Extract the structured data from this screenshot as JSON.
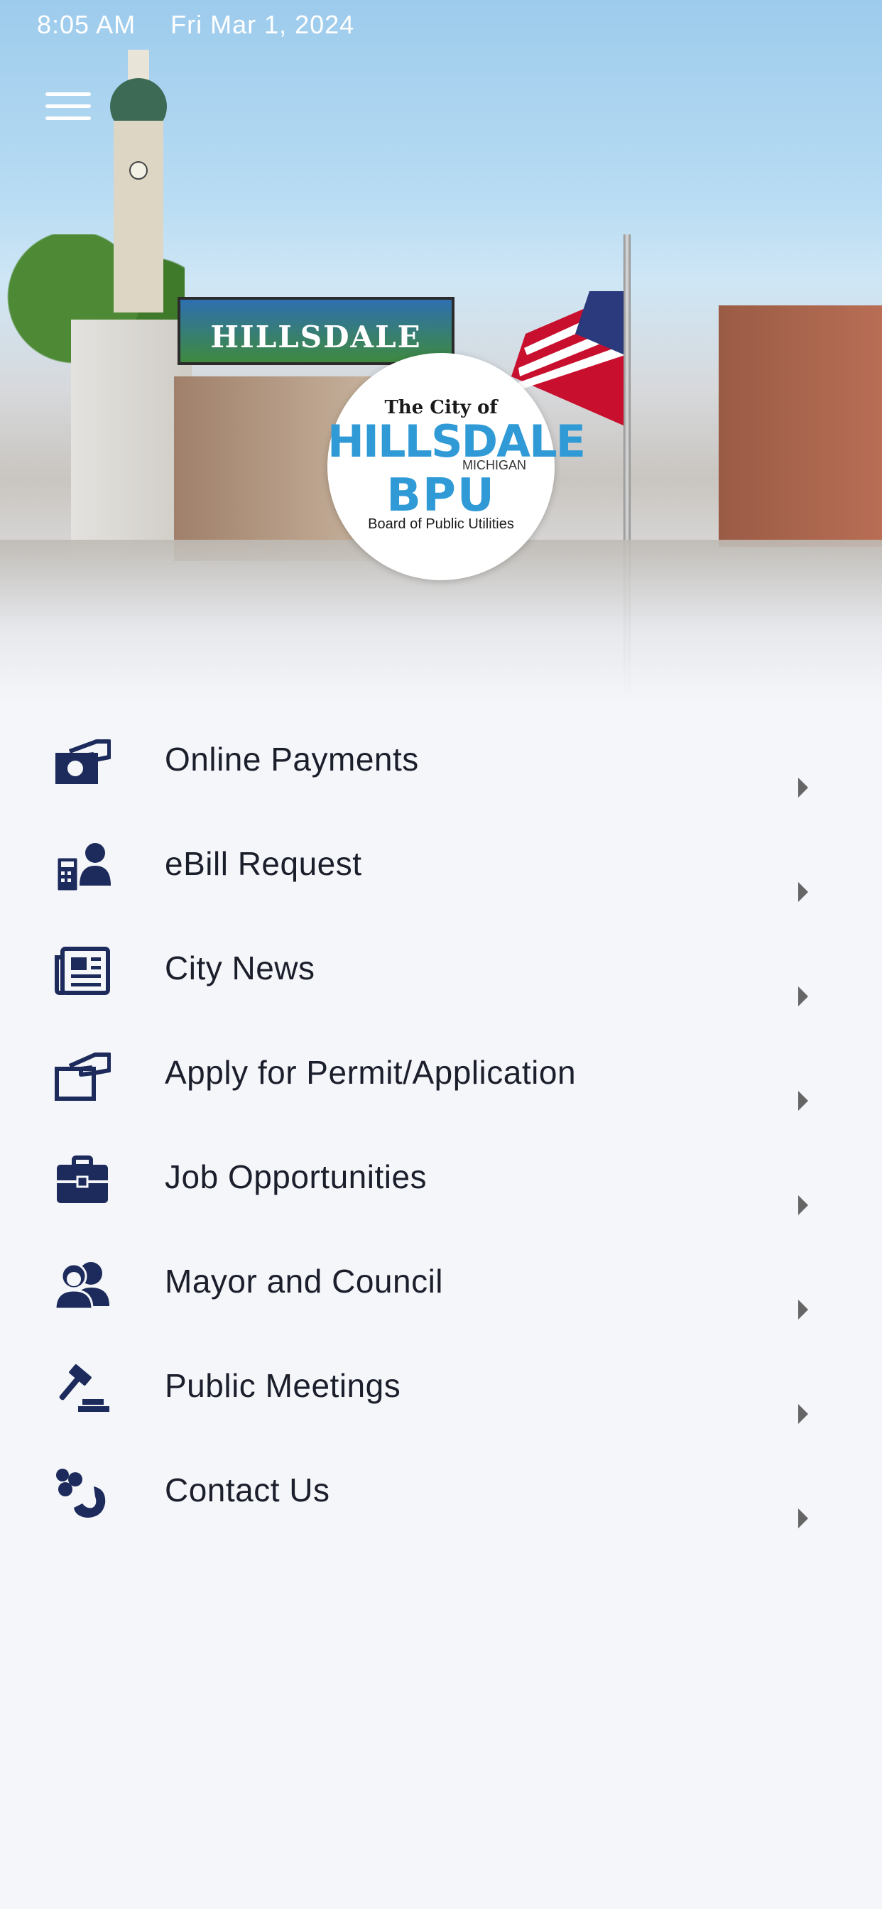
{
  "status_bar": {
    "time": "8:05 AM",
    "date": "Fri Mar 1, 2024"
  },
  "hero": {
    "billboard": "HILLSDALE",
    "logo": {
      "line1": "The City of",
      "line2": "HILLSDALE",
      "line3": "MICHIGAN",
      "line4": "BPU",
      "line5": "Board of Public Utilities"
    }
  },
  "menu": {
    "items": [
      {
        "label": "Online Payments",
        "icon": "payment-hand-icon"
      },
      {
        "label": "eBill Request",
        "icon": "calculator-user-icon"
      },
      {
        "label": "City News",
        "icon": "newspaper-icon"
      },
      {
        "label": "Apply for Permit/Application",
        "icon": "hand-document-icon"
      },
      {
        "label": "Job Opportunities",
        "icon": "briefcase-icon"
      },
      {
        "label": "Mayor and Council",
        "icon": "people-icon"
      },
      {
        "label": "Public Meetings",
        "icon": "gavel-icon"
      },
      {
        "label": "Contact Us",
        "icon": "phone-people-icon"
      }
    ]
  },
  "colors": {
    "icon": "#1d2b5c",
    "text": "#1b1e2b",
    "background": "#f4f6f9",
    "logo_blue": "#2f9ad6"
  }
}
